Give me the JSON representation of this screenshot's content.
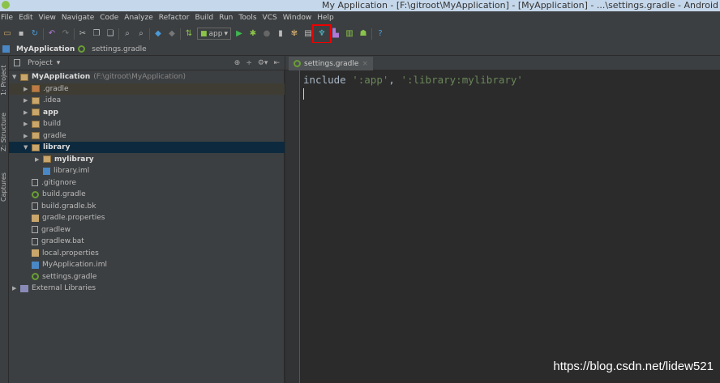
{
  "window": {
    "title": "My Application - [F:\\gitroot\\MyApplication] - [MyApplication] - ...\\settings.gradle - Android"
  },
  "menu": [
    "File",
    "Edit",
    "View",
    "Navigate",
    "Code",
    "Analyze",
    "Refactor",
    "Build",
    "Run",
    "Tools",
    "VCS",
    "Window",
    "Help"
  ],
  "toolbar": {
    "run_config": "app",
    "highlighted": "sdk-manager-icon"
  },
  "navbar": {
    "project": "MyApplication",
    "file": "settings.gradle"
  },
  "side_tabs": [
    "1: Project",
    "Z: Structure",
    "Captures"
  ],
  "project_panel": {
    "view": "Project"
  },
  "tree": [
    {
      "label": "MyApplication",
      "extra": "(F:\\gitroot\\MyApplication)",
      "depth": 0,
      "icon": "module",
      "expanded": true,
      "bold": true
    },
    {
      "label": ".gradle",
      "depth": 1,
      "icon": "folder-orange",
      "expanded": false
    },
    {
      "label": ".idea",
      "depth": 1,
      "icon": "folder",
      "expanded": false
    },
    {
      "label": "app",
      "depth": 1,
      "icon": "module",
      "expanded": false,
      "bold": true
    },
    {
      "label": "build",
      "depth": 1,
      "icon": "folder",
      "expanded": false
    },
    {
      "label": "gradle",
      "depth": 1,
      "icon": "folder",
      "expanded": false
    },
    {
      "label": "library",
      "depth": 1,
      "icon": "module",
      "expanded": true,
      "bold": true,
      "selected": true
    },
    {
      "label": "mylibrary",
      "depth": 2,
      "icon": "module",
      "expanded": false,
      "bold": true
    },
    {
      "label": "library.iml",
      "depth": 2,
      "icon": "iml"
    },
    {
      "label": ".gitignore",
      "depth": 1,
      "icon": "file"
    },
    {
      "label": "build.gradle",
      "depth": 1,
      "icon": "gradle"
    },
    {
      "label": "build.gradle.bk",
      "depth": 1,
      "icon": "file"
    },
    {
      "label": "gradle.properties",
      "depth": 1,
      "icon": "props"
    },
    {
      "label": "gradlew",
      "depth": 1,
      "icon": "file"
    },
    {
      "label": "gradlew.bat",
      "depth": 1,
      "icon": "file"
    },
    {
      "label": "local.properties",
      "depth": 1,
      "icon": "props"
    },
    {
      "label": "MyApplication.iml",
      "depth": 1,
      "icon": "iml"
    },
    {
      "label": "settings.gradle",
      "depth": 1,
      "icon": "gradle"
    },
    {
      "label": "External Libraries",
      "depth": 0,
      "icon": "lib",
      "expanded": false
    }
  ],
  "editor": {
    "tab": "settings.gradle",
    "code": {
      "kw": "include ",
      "s1": "':app'",
      "sep": ", ",
      "s2": "':library:mylibrary'"
    }
  },
  "watermark": "https://blog.csdn.net/lidew521"
}
